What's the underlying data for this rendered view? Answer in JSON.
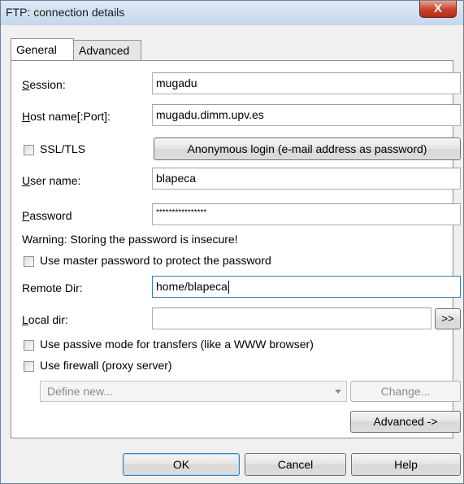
{
  "window": {
    "title": "FTP: connection details",
    "close_label": "X"
  },
  "tabs": [
    {
      "label": "General",
      "active": true
    },
    {
      "label": "Advanced",
      "active": false
    }
  ],
  "form": {
    "session_label": "Session:",
    "session_value": "mugadu",
    "host_label": "Host name[:Port]:",
    "host_value": "mugadu.dimm.upv.es",
    "ssl_label": "SSL/TLS",
    "anonymous_button": "Anonymous login (e-mail address as password)",
    "user_label": "User name:",
    "user_value": "blapeca",
    "password_label": "Password",
    "password_value": "****************",
    "warning_text": "Warning: Storing the password is insecure!",
    "master_password_label": "Use master password to protect the password",
    "remote_dir_label": "Remote Dir:",
    "remote_dir_value": "home/blapeca",
    "local_dir_label": "Local dir:",
    "local_dir_value": "",
    "browse_button": ">>",
    "passive_mode_label": "Use passive mode for transfers (like a WWW browser)",
    "firewall_label": "Use firewall (proxy server)",
    "proxy_select_value": "Define new...",
    "change_button": "Change...",
    "advanced_button": "Advanced ->"
  },
  "footer": {
    "ok": "OK",
    "cancel": "Cancel",
    "help": "Help"
  }
}
